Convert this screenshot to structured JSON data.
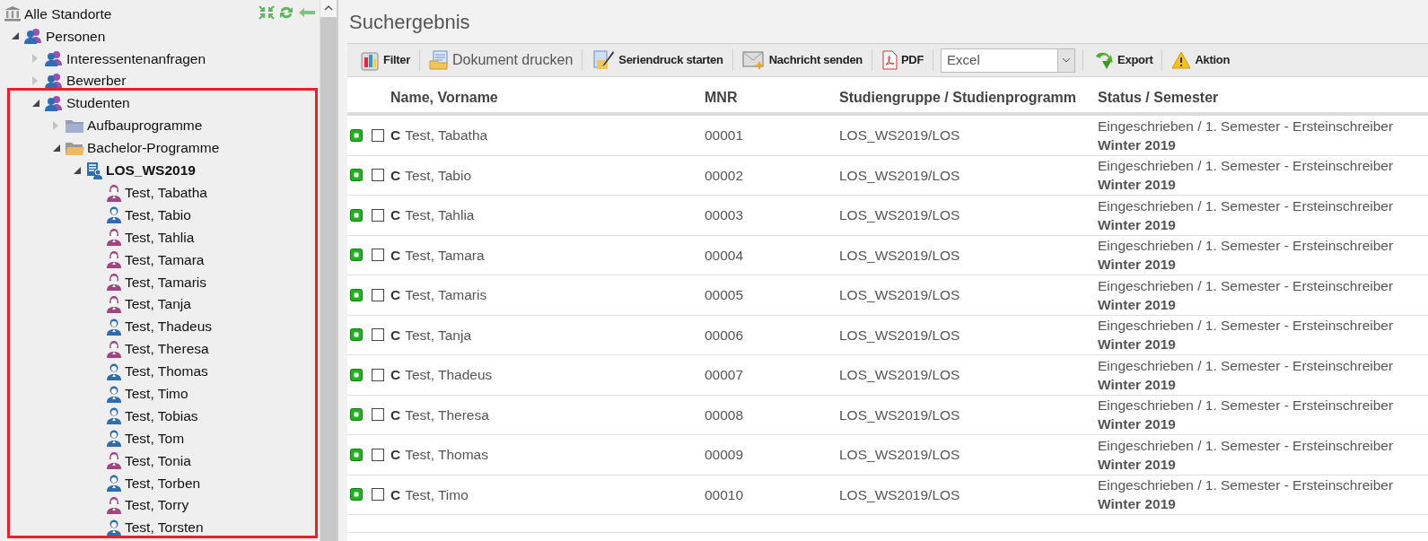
{
  "tree": {
    "label": "Alle Standorte",
    "kind": "site",
    "selected": false,
    "children": [
      {
        "label": "Personen",
        "kind": "group",
        "selected": false,
        "expanded": true,
        "children": [
          {
            "label": "Interessentenanfragen",
            "kind": "group",
            "selected": false,
            "expanded": false
          },
          {
            "label": "Bewerber",
            "kind": "group",
            "selected": false,
            "expanded": false
          },
          {
            "label": "Studenten",
            "kind": "group",
            "selected": false,
            "expanded": true,
            "children": [
              {
                "label": "Aufbauprogramme",
                "kind": "folder",
                "selected": false,
                "expanded": false
              },
              {
                "label": "Bachelor-Programme",
                "kind": "folder",
                "selected": false,
                "expanded": true,
                "children": [
                  {
                    "label": "LOS_WS2019",
                    "kind": "program",
                    "selected": true,
                    "expanded": true,
                    "children": [
                      {
                        "label": "Test, Tabatha",
                        "kind": "female",
                        "selected": false
                      },
                      {
                        "label": "Test, Tabio",
                        "kind": "male",
                        "selected": false
                      },
                      {
                        "label": "Test, Tahlia",
                        "kind": "female",
                        "selected": false
                      },
                      {
                        "label": "Test, Tamara",
                        "kind": "female",
                        "selected": false
                      },
                      {
                        "label": "Test, Tamaris",
                        "kind": "female",
                        "selected": false
                      },
                      {
                        "label": "Test, Tanja",
                        "kind": "female",
                        "selected": false
                      },
                      {
                        "label": "Test, Thadeus",
                        "kind": "male",
                        "selected": false
                      },
                      {
                        "label": "Test, Theresa",
                        "kind": "female",
                        "selected": false
                      },
                      {
                        "label": "Test, Thomas",
                        "kind": "male",
                        "selected": false
                      },
                      {
                        "label": "Test, Timo",
                        "kind": "male",
                        "selected": false
                      },
                      {
                        "label": "Test, Tobias",
                        "kind": "male",
                        "selected": false
                      },
                      {
                        "label": "Test, Tom",
                        "kind": "male",
                        "selected": false
                      },
                      {
                        "label": "Test, Tonia",
                        "kind": "female",
                        "selected": false
                      },
                      {
                        "label": "Test, Torben",
                        "kind": "male",
                        "selected": false
                      },
                      {
                        "label": "Test, Torry",
                        "kind": "female",
                        "selected": false
                      },
                      {
                        "label": "Test, Torsten",
                        "kind": "male",
                        "selected": false
                      }
                    ]
                  }
                ]
              }
            ]
          }
        ]
      }
    ]
  },
  "title": "Suchergebnis",
  "toolbar": [
    {
      "kind": "filter",
      "label": "Filter"
    },
    {
      "kind": "print",
      "label": "Dokument drucken",
      "large": true
    },
    {
      "kind": "mailmerge",
      "label": "Seriendruck starten"
    },
    {
      "kind": "message",
      "label": "Nachricht senden"
    },
    {
      "kind": "pdf",
      "label": "PDF"
    },
    {
      "kind": "select",
      "value": "Excel"
    },
    {
      "kind": "export",
      "label": "Export"
    },
    {
      "kind": "action",
      "label": "Aktion"
    }
  ],
  "table": {
    "columns": [
      "Name, Vorname",
      "MNR",
      "Studiengruppe / Studienprogramm",
      "Status / Semester"
    ],
    "rows": [
      {
        "checked": false,
        "flag": "C",
        "name": "Test, Tabatha",
        "mnr": "00001",
        "group": "LOS_WS2019/LOS",
        "status": "Eingeschrieben / 1. Semester - Ersteinschreiber",
        "semester": "Winter 2019"
      },
      {
        "checked": false,
        "flag": "C",
        "name": "Test, Tabio",
        "mnr": "00002",
        "group": "LOS_WS2019/LOS",
        "status": "Eingeschrieben / 1. Semester - Ersteinschreiber",
        "semester": "Winter 2019"
      },
      {
        "checked": false,
        "flag": "C",
        "name": "Test, Tahlia",
        "mnr": "00003",
        "group": "LOS_WS2019/LOS",
        "status": "Eingeschrieben / 1. Semester - Ersteinschreiber",
        "semester": "Winter 2019"
      },
      {
        "checked": false,
        "flag": "C",
        "name": "Test, Tamara",
        "mnr": "00004",
        "group": "LOS_WS2019/LOS",
        "status": "Eingeschrieben / 1. Semester - Ersteinschreiber",
        "semester": "Winter 2019"
      },
      {
        "checked": false,
        "flag": "C",
        "name": "Test, Tamaris",
        "mnr": "00005",
        "group": "LOS_WS2019/LOS",
        "status": "Eingeschrieben / 1. Semester - Ersteinschreiber",
        "semester": "Winter 2019"
      },
      {
        "checked": false,
        "flag": "C",
        "name": "Test, Tanja",
        "mnr": "00006",
        "group": "LOS_WS2019/LOS",
        "status": "Eingeschrieben / 1. Semester - Ersteinschreiber",
        "semester": "Winter 2019"
      },
      {
        "checked": false,
        "flag": "C",
        "name": "Test, Thadeus",
        "mnr": "00007",
        "group": "LOS_WS2019/LOS",
        "status": "Eingeschrieben / 1. Semester - Ersteinschreiber",
        "semester": "Winter 2019"
      },
      {
        "checked": false,
        "flag": "C",
        "name": "Test, Theresa",
        "mnr": "00008",
        "group": "LOS_WS2019/LOS",
        "status": "Eingeschrieben / 1. Semester - Ersteinschreiber",
        "semester": "Winter 2019"
      },
      {
        "checked": false,
        "flag": "C",
        "name": "Test, Thomas",
        "mnr": "00009",
        "group": "LOS_WS2019/LOS",
        "status": "Eingeschrieben / 1. Semester - Ersteinschreiber",
        "semester": "Winter 2019"
      },
      {
        "checked": false,
        "flag": "C",
        "name": "Test, Timo",
        "mnr": "00010",
        "group": "LOS_WS2019/LOS",
        "status": "Eingeschrieben / 1. Semester - Ersteinschreiber",
        "semester": "Winter 2019"
      }
    ]
  }
}
